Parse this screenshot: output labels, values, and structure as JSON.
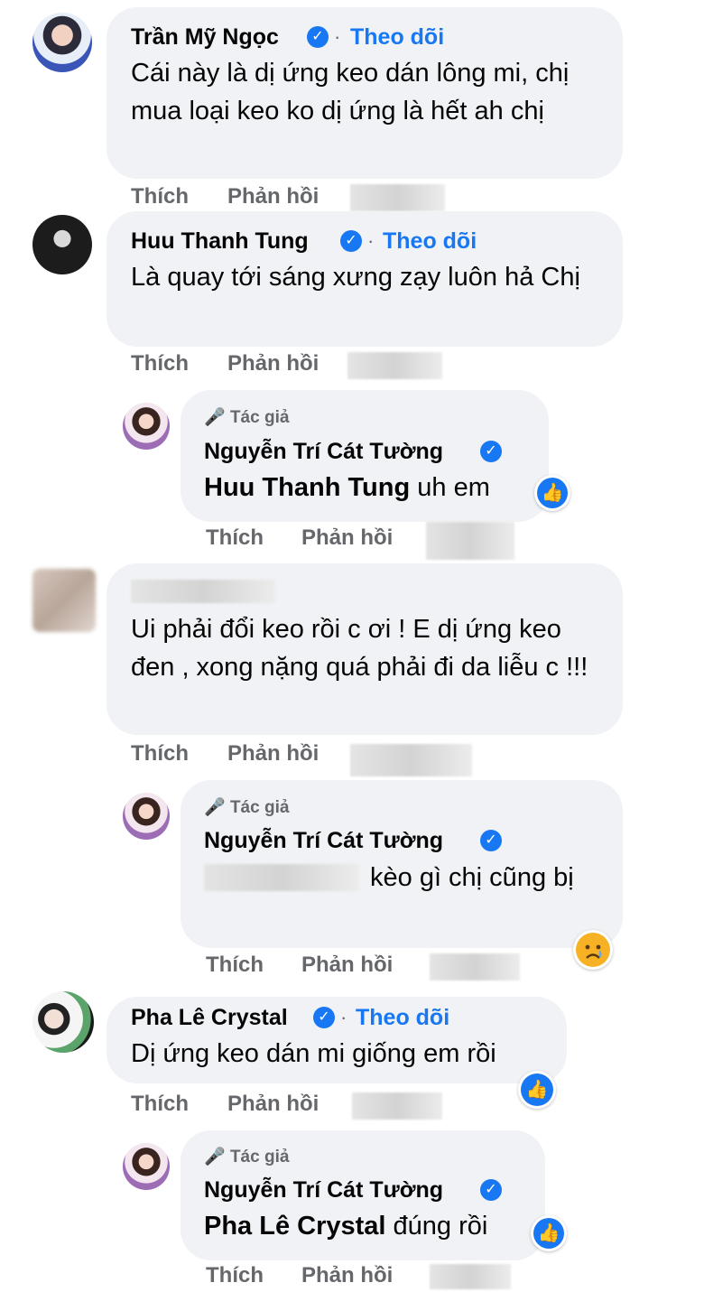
{
  "labels": {
    "follow": "Theo dõi",
    "like": "Thích",
    "reply": "Phản hồi",
    "author_tag": "Tác giả",
    "separator": "·"
  },
  "comments": [
    {
      "author": "Trần Mỹ Ngọc",
      "text": "Cái này là dị ứng keo dán lông mi, chị mua loại keo ko dị ứng là hết ah chị"
    },
    {
      "author": "Huu Thanh Tung",
      "text": "Là quay tới sáng xưng zạy luôn hả Chị",
      "reply": {
        "author": "Nguyễn Trí Cát Tường",
        "mention": "Huu Thanh Tung",
        "text": "uh em",
        "reaction": "like"
      }
    },
    {
      "author": "",
      "text": "Ui phải đổi keo rồi c ơi ! E dị ứng keo đen , xong nặng quá phải đi da liễu c !!!",
      "reply": {
        "author": "Nguyễn Trí Cát Tường",
        "text": "kèo gì chị cũng bị",
        "reaction": "sad"
      }
    },
    {
      "author": "Pha Lê Crystal",
      "text": "Dị ứng keo dán mi giống em rồi",
      "reaction": "like",
      "reply": {
        "author": "Nguyễn Trí Cát Tường",
        "mention": "Pha Lê Crystal",
        "text": "đúng rồi",
        "reaction": "like"
      }
    }
  ],
  "colors": {
    "bubble": "#f0f2f5",
    "accent": "#1877f2",
    "meta": "#65676b"
  }
}
